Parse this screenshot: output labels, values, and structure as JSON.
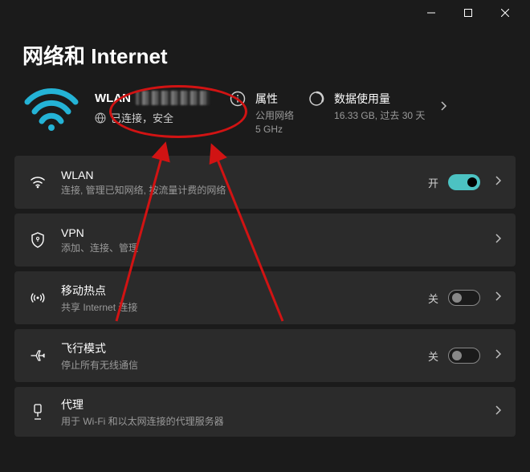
{
  "titlebar": {
    "minimize_tooltip": "最小化",
    "maximize_tooltip": "最大化",
    "close_tooltip": "关闭"
  },
  "page_title": "网络和 Internet",
  "current_network": {
    "name_prefix": "WLAN",
    "status_text": "已连接，安全"
  },
  "properties": {
    "title": "属性",
    "line1": "公用网络",
    "line2": "5 GHz"
  },
  "data_usage": {
    "title": "数据使用量",
    "subtitle": "16.33 GB, 过去 30 天"
  },
  "settings": {
    "wlan": {
      "title": "WLAN",
      "subtitle": "连接, 管理已知网络, 按流量计费的网络",
      "state_label": "开",
      "on": true
    },
    "vpn": {
      "title": "VPN",
      "subtitle": "添加、连接、管理"
    },
    "hotspot": {
      "title": "移动热点",
      "subtitle": "共享 Internet 连接",
      "state_label": "关",
      "on": false
    },
    "airplane": {
      "title": "飞行模式",
      "subtitle": "停止所有无线通信",
      "state_label": "关",
      "on": false
    },
    "proxy": {
      "title": "代理",
      "subtitle": "用于 Wi-Fi 和以太网连接的代理服务器"
    }
  }
}
